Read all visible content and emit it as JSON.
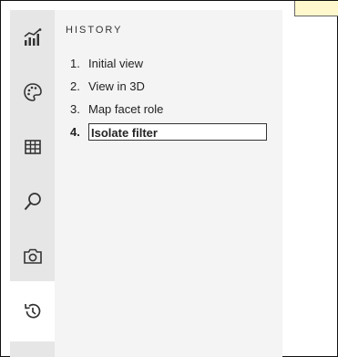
{
  "panel": {
    "title": "HISTORY"
  },
  "sidebar": {
    "tabs": [
      {
        "icon": "chart-icon",
        "label": ""
      },
      {
        "icon": "palette-icon",
        "label": ""
      },
      {
        "icon": "table-icon",
        "label": ""
      },
      {
        "icon": "search-icon",
        "label": ""
      },
      {
        "icon": "camera-icon",
        "label": ""
      },
      {
        "icon": "history-icon",
        "label": "",
        "active": true
      }
    ]
  },
  "history": {
    "items": [
      {
        "number": "1.",
        "label": "Initial view"
      },
      {
        "number": "2.",
        "label": "View in 3D"
      },
      {
        "number": "3.",
        "label": "Map facet role"
      },
      {
        "number": "4.",
        "label": "Isolate filter",
        "current": true
      }
    ]
  },
  "colors": {
    "sidebar_bg": "#e6e6e6",
    "panel_bg": "#f4f4f4",
    "tooltip_bg": "#fff8cc"
  }
}
